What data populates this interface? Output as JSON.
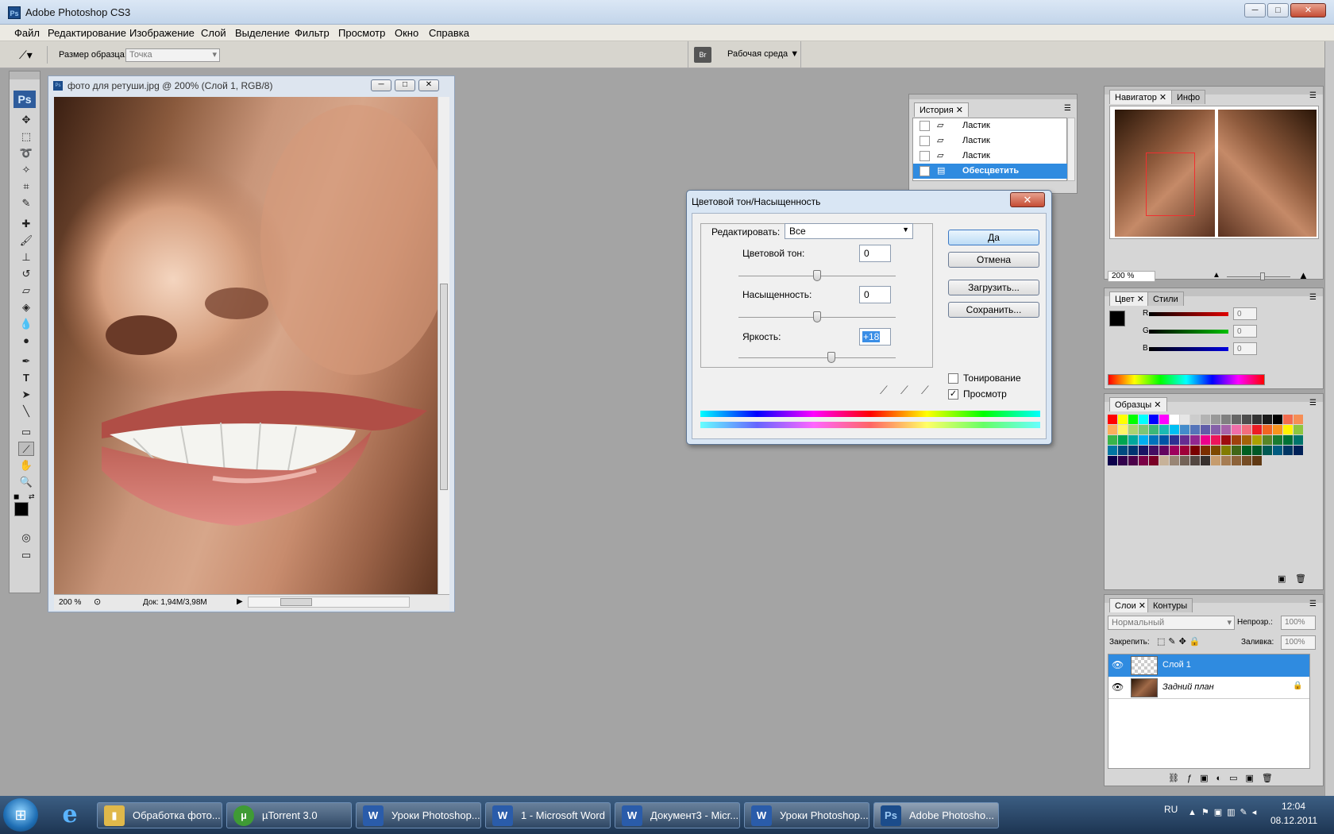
{
  "window": {
    "title": "Adobe Photoshop CS3",
    "min_label": "─",
    "max_label": "□",
    "close_label": "✕"
  },
  "menu": [
    "Файл",
    "Редактирование",
    "Изображение",
    "Слой",
    "Выделение",
    "Фильтр",
    "Просмотр",
    "Окно",
    "Справка"
  ],
  "options": {
    "sample_label": "Размер образца:",
    "sample_value": "Точка",
    "workspace_label": "Рабочая среда ▼"
  },
  "document": {
    "title": "фото для ретуши.jpg @ 200% (Слой 1, RGB/8)",
    "zoom": "200 %",
    "doc_info": "Док: 1,94M/3,98M"
  },
  "history": {
    "tab": "История",
    "items": [
      "Ластик",
      "Ластик",
      "Ластик",
      "Обесцветить"
    ]
  },
  "navigator": {
    "tab_nav": "Навигатор",
    "tab_info": "Инфо",
    "zoom": "200 %"
  },
  "color_panel": {
    "tab_color": "Цвет",
    "tab_styles": "Стили",
    "channels": [
      {
        "name": "R",
        "value": "0",
        "color": "#e00000"
      },
      {
        "name": "G",
        "value": "0",
        "color": "#00c000"
      },
      {
        "name": "B",
        "value": "0",
        "color": "#0000e0"
      }
    ]
  },
  "swatches": {
    "tab": "Образцы",
    "colors": [
      "#ff0000",
      "#ffff00",
      "#00ff00",
      "#00ffff",
      "#0000ff",
      "#ff00ff",
      "#ffffff",
      "#e6e6e6",
      "#cccccc",
      "#b3b3b3",
      "#999999",
      "#808080",
      "#666666",
      "#4d4d4d",
      "#333333",
      "#1a1a1a",
      "#000000",
      "#f26c4f",
      "#f68e55",
      "#fbaf5c",
      "#fff467",
      "#acd372",
      "#7cc576",
      "#3bb878",
      "#1abbb4",
      "#00bff3",
      "#438ccb",
      "#5574b9",
      "#605ca8",
      "#855fa8",
      "#a763a8",
      "#f06ea9",
      "#f26d7d",
      "#ed1c24",
      "#f26522",
      "#f7941d",
      "#fff200",
      "#8dc63f",
      "#39b54a",
      "#00a651",
      "#00a99d",
      "#00aeef",
      "#0072bc",
      "#0054a6",
      "#2e3192",
      "#662d91",
      "#92278f",
      "#ec008c",
      "#ed145b",
      "#9e0b0f",
      "#a0410d",
      "#a36209",
      "#aba000",
      "#598527",
      "#1a7b30",
      "#007236",
      "#00746b",
      "#0076a3",
      "#004b80",
      "#003471",
      "#1b1464",
      "#440e62",
      "#630460",
      "#9e005d",
      "#9e0039",
      "#790000",
      "#7b2e00",
      "#7d4900",
      "#827b00",
      "#406618",
      "#005e20",
      "#005826",
      "#005952",
      "#005b7f",
      "#003663",
      "#002157",
      "#0d004c",
      "#32004b",
      "#4b0049",
      "#7b0046",
      "#7a0026",
      "#c7b299",
      "#998675",
      "#736357",
      "#534741",
      "#37302d",
      "#c69c6d",
      "#a67c52",
      "#8c6239",
      "#754c24",
      "#603913"
    ]
  },
  "layers": {
    "tab_layers": "Слои",
    "tab_paths": "Контуры",
    "blend_mode": "Нормальный",
    "opacity_label": "Непрозр.:",
    "opacity_value": "100%",
    "lock_label": "Закрепить:",
    "fill_label": "Заливка:",
    "fill_value": "100%",
    "items": [
      {
        "name": "Слой 1",
        "selected": true
      },
      {
        "name": "Задний план",
        "selected": false
      }
    ]
  },
  "dialog": {
    "title": "Цветовой тон/Насыщенность",
    "edit_label": "Редактировать:",
    "edit_value": "Все",
    "hue_label": "Цветовой тон:",
    "hue_value": "0",
    "saturation_label": "Насыщенность:",
    "saturation_value": "0",
    "lightness_label": "Яркость:",
    "lightness_value": "+18",
    "ok": "Да",
    "cancel": "Отмена",
    "load": "Загрузить...",
    "save": "Сохранить...",
    "colorize_label": "Тонирование",
    "colorize_checked": false,
    "preview_label": "Просмотр",
    "preview_checked": true
  },
  "taskbar": {
    "items": [
      {
        "label": "Обработка фото...",
        "icon": "folder-icon",
        "color": "#e0b84a"
      },
      {
        "label": "µTorrent 3.0",
        "icon": "utorrent-icon",
        "color": "#3f9b35"
      },
      {
        "label": "Уроки Photoshop...",
        "icon": "word-icon",
        "color": "#2a5caa"
      },
      {
        "label": "1 - Microsoft Word",
        "icon": "word-icon",
        "color": "#2a5caa"
      },
      {
        "label": "Документ3 - Micr...",
        "icon": "word-icon",
        "color": "#2a5caa"
      },
      {
        "label": "Уроки Photoshop...",
        "icon": "word-icon",
        "color": "#2a5caa"
      },
      {
        "label": "Adobe Photosho...",
        "icon": "photoshop-icon",
        "color": "#1b4c8b"
      }
    ],
    "language": "RU",
    "time": "12:04",
    "date": "08.12.2011"
  }
}
